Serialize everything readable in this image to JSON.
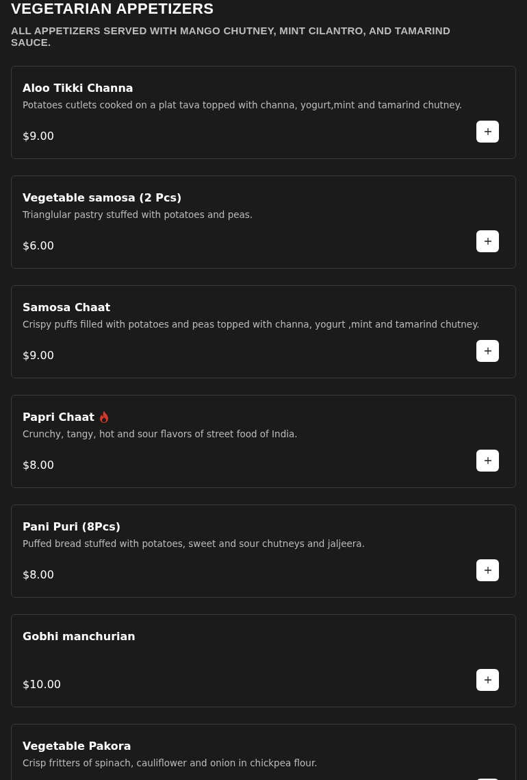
{
  "section": {
    "title": "VEGETARIAN APPETIZERS",
    "subtitle": "ALL APPETIZERS SERVED WITH MANGO CHUTNEY, MINT CILANTRO, AND TAMARIND SAUCE."
  },
  "items": [
    {
      "name": "Aloo Tikki Channa",
      "spicy": false,
      "description": "Potatoes cutlets cooked on a plat tava topped with channa, yogurt,mint and tamarind chutney.",
      "price": "$9.00"
    },
    {
      "name": "Vegetable samosa (2 Pcs)",
      "spicy": false,
      "description": "Trianglular pastry stuffed with potatoes and peas.",
      "price": "$6.00"
    },
    {
      "name": "Samosa Chaat",
      "spicy": false,
      "description": "Crispy puffs filled with potatoes and peas topped with channa, yogurt ,mint and tamarind chutney.",
      "price": "$9.00"
    },
    {
      "name": "Papri Chaat",
      "spicy": true,
      "description": "Crunchy, tangy, hot and sour flavors of street food of India.",
      "price": "$8.00"
    },
    {
      "name": "Pani Puri (8Pcs)",
      "spicy": false,
      "description": "Puffed bread stuffed with potatoes, sweet and sour chutneys and jaljeera.",
      "price": "$8.00"
    },
    {
      "name": "Gobhi manchurian",
      "spicy": false,
      "price": "$10.00"
    },
    {
      "name": "Vegetable Pakora",
      "spicy": false,
      "description": "Crisp fritters of spinach, cauliflower and onion in chickpea flour."
    }
  ]
}
